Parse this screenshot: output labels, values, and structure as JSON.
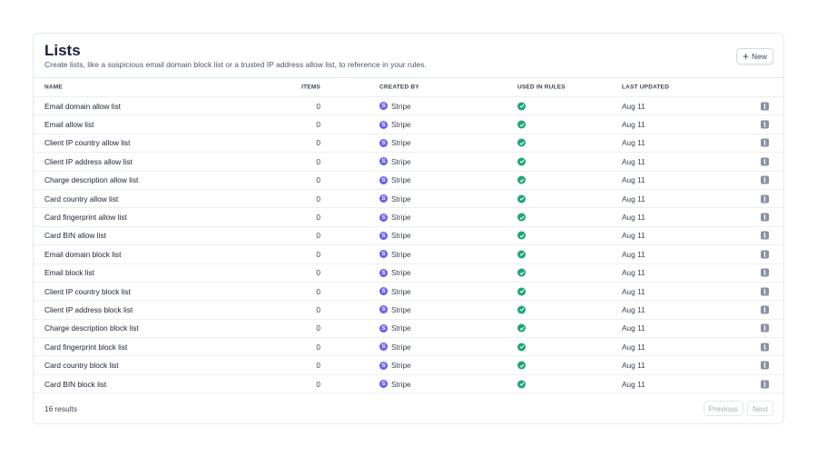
{
  "header": {
    "title": "Lists",
    "subtitle": "Create lists, like a suspicious email domain block list or a trusted IP address allow list, to reference in your rules.",
    "new_label": "New"
  },
  "columns": {
    "name": "NAME",
    "items": "ITEMS",
    "created_by": "CREATED BY",
    "used_in_rules": "USED IN RULES",
    "last_updated": "LAST UPDATED"
  },
  "rows": [
    {
      "name": "Email domain allow list",
      "items": "0",
      "created_by": "Stripe",
      "used": true,
      "updated": "Aug 11"
    },
    {
      "name": "Email allow list",
      "items": "0",
      "created_by": "Stripe",
      "used": true,
      "updated": "Aug 11"
    },
    {
      "name": "Client IP country allow list",
      "items": "0",
      "created_by": "Stripe",
      "used": true,
      "updated": "Aug 11"
    },
    {
      "name": "Client IP address allow list",
      "items": "0",
      "created_by": "Stripe",
      "used": true,
      "updated": "Aug 11"
    },
    {
      "name": "Charge description allow list",
      "items": "0",
      "created_by": "Stripe",
      "used": true,
      "updated": "Aug 11"
    },
    {
      "name": "Card country allow list",
      "items": "0",
      "created_by": "Stripe",
      "used": true,
      "updated": "Aug 11"
    },
    {
      "name": "Card fingerprint allow list",
      "items": "0",
      "created_by": "Stripe",
      "used": true,
      "updated": "Aug 11"
    },
    {
      "name": "Card BIN allow list",
      "items": "0",
      "created_by": "Stripe",
      "used": true,
      "updated": "Aug 11"
    },
    {
      "name": "Email domain block list",
      "items": "0",
      "created_by": "Stripe",
      "used": true,
      "updated": "Aug 11"
    },
    {
      "name": "Email block list",
      "items": "0",
      "created_by": "Stripe",
      "used": true,
      "updated": "Aug 11"
    },
    {
      "name": "Client IP country block list",
      "items": "0",
      "created_by": "Stripe",
      "used": true,
      "updated": "Aug 11"
    },
    {
      "name": "Client IP address block list",
      "items": "0",
      "created_by": "Stripe",
      "used": true,
      "updated": "Aug 11"
    },
    {
      "name": "Charge description block list",
      "items": "0",
      "created_by": "Stripe",
      "used": true,
      "updated": "Aug 11"
    },
    {
      "name": "Card fingerprint block list",
      "items": "0",
      "created_by": "Stripe",
      "used": true,
      "updated": "Aug 11"
    },
    {
      "name": "Card country block list",
      "items": "0",
      "created_by": "Stripe",
      "used": true,
      "updated": "Aug 11"
    },
    {
      "name": "Card BIN block list",
      "items": "0",
      "created_by": "Stripe",
      "used": true,
      "updated": "Aug 11"
    }
  ],
  "footer": {
    "results": "16 results",
    "previous": "Previous",
    "next": "Next"
  },
  "colors": {
    "brand": "#635bff",
    "success": "#1ea672"
  }
}
